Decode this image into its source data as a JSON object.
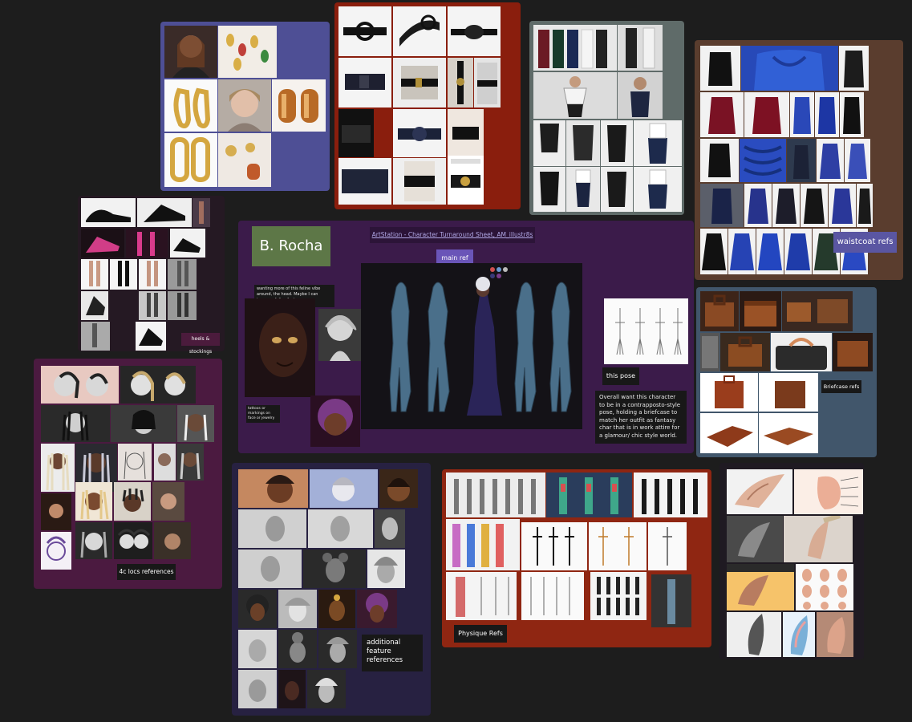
{
  "colors": {
    "canvas": "#1d1d1d",
    "board_earrings": "#4e4f95",
    "board_belts": "#8a1e0d",
    "board_skirts": "#5f6b69",
    "board_waistcoat": "#5a3d2e",
    "board_main": "#3b1b4a",
    "board_briefcase": "#41566b",
    "board_locs": "#4b1a40",
    "board_features": "#272141",
    "board_physique": "#8f2612",
    "board_shoes": "#251923",
    "board_ears": "#1f1a22",
    "character_tag": "#5d7747",
    "main_ref_tag": "#6a55b8",
    "waistcoat_tag": "#5a56a2"
  },
  "main": {
    "name_tag": "B. Rocha",
    "link_text": "ArtStation - Character Turnaround Sheet, AM_illustr8s",
    "main_ref_label": "main ref",
    "this_pose_label": "this pose",
    "pose_note": "Overall want this character to be in a contrapposto-style pose, holding a briefcase to match her outfit as fantasy char that is in work attire for a glamour/ chic style world.",
    "small_note_1": "wanting more of this feline vibe around, the head. Maybe I can increase feline features or alternative to animal skin.",
    "small_note_2": "tattoos or markings on face or jewelry"
  },
  "labels": {
    "waistcoat": "waistcoat refs",
    "briefcase": "Briefcase refs",
    "heels": "heels & stockings",
    "locs": "4c locs references",
    "features": "additional feature references",
    "physique": "Physique Refs"
  }
}
